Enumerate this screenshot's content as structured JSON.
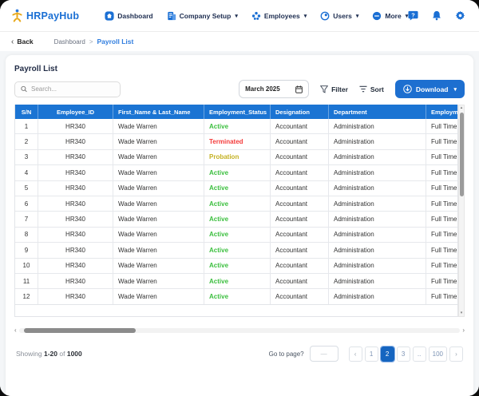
{
  "navbar": {
    "brand": "HRPayHub",
    "items": [
      {
        "label": "Dashboard",
        "caret": false
      },
      {
        "label": "Company Setup",
        "caret": true
      },
      {
        "label": "Employees",
        "caret": true
      },
      {
        "label": "Users",
        "caret": true
      },
      {
        "label": "More",
        "caret": true
      }
    ],
    "caret_char": "▾"
  },
  "breadcrumb": {
    "back_chevron": "‹",
    "back_label": "Back",
    "parent": "Dashboard",
    "separator": ">",
    "current": "Payroll List"
  },
  "page": {
    "title": "Payroll List"
  },
  "toolbar": {
    "search_placeholder": "Search...",
    "month": "March 2025",
    "filter_label": "Filter",
    "sort_label": "Sort",
    "download_label": "Download",
    "download_caret": "▾"
  },
  "table": {
    "headers": [
      "S/N",
      "Employee_ID",
      "First_Name & Last_Name",
      "Employment_Status",
      "Designation",
      "Department",
      "Employment_Type"
    ],
    "rows": [
      {
        "sn": "1",
        "id": "HR340",
        "name": "Wade Warren",
        "status": "Active",
        "designation": "Accountant",
        "department": "Administration",
        "type": "Full Time"
      },
      {
        "sn": "2",
        "id": "HR340",
        "name": "Wade Warren",
        "status": "Terminated",
        "designation": "Accountant",
        "department": "Administration",
        "type": "Full Time"
      },
      {
        "sn": "3",
        "id": "HR340",
        "name": "Wade Warren",
        "status": "Probation",
        "designation": "Accountant",
        "department": "Administration",
        "type": "Full Time"
      },
      {
        "sn": "4",
        "id": "HR340",
        "name": "Wade Warren",
        "status": "Active",
        "designation": "Accountant",
        "department": "Administration",
        "type": "Full Time"
      },
      {
        "sn": "5",
        "id": "HR340",
        "name": "Wade Warren",
        "status": "Active",
        "designation": "Accountant",
        "department": "Administration",
        "type": "Full Time"
      },
      {
        "sn": "6",
        "id": "HR340",
        "name": "Wade Warren",
        "status": "Active",
        "designation": "Accountant",
        "department": "Administration",
        "type": "Full Time"
      },
      {
        "sn": "7",
        "id": "HR340",
        "name": "Wade Warren",
        "status": "Active",
        "designation": "Accountant",
        "department": "Administration",
        "type": "Full Time"
      },
      {
        "sn": "8",
        "id": "HR340",
        "name": "Wade Warren",
        "status": "Active",
        "designation": "Accountant",
        "department": "Administration",
        "type": "Full Time"
      },
      {
        "sn": "9",
        "id": "HR340",
        "name": "Wade Warren",
        "status": "Active",
        "designation": "Accountant",
        "department": "Administration",
        "type": "Full Time"
      },
      {
        "sn": "10",
        "id": "HR340",
        "name": "Wade Warren",
        "status": "Active",
        "designation": "Accountant",
        "department": "Administration",
        "type": "Full Time"
      },
      {
        "sn": "11",
        "id": "HR340",
        "name": "Wade Warren",
        "status": "Active",
        "designation": "Accountant",
        "department": "Administration",
        "type": "Full Time"
      },
      {
        "sn": "12",
        "id": "HR340",
        "name": "Wade Warren",
        "status": "Active",
        "designation": "Accountant",
        "department": "Administration",
        "type": "Full Time"
      }
    ]
  },
  "scrollbars": {
    "up": "▴",
    "down": "▾",
    "left": "‹",
    "right": "›"
  },
  "footer": {
    "showing_prefix": "Showing",
    "range": "1-20",
    "of_word": "of",
    "total": "1000",
    "goto_label": "Go to page?",
    "goto_placeholder": "—",
    "pagination": {
      "prev": "‹",
      "next": "›",
      "pages": [
        {
          "label": "1"
        },
        {
          "label": "2",
          "active": true
        },
        {
          "label": "3"
        },
        {
          "label": ".."
        },
        {
          "label": "100"
        }
      ]
    }
  },
  "colors": {
    "primary_blue": "#1b74d3",
    "download_blue": "#1d6fd0",
    "active_page_blue": "#1565c0",
    "status_active": "#3cbf3f",
    "status_terminated": "#f43b3b",
    "status_probation": "#c4b121",
    "brand_gold": "#e8a91d"
  }
}
